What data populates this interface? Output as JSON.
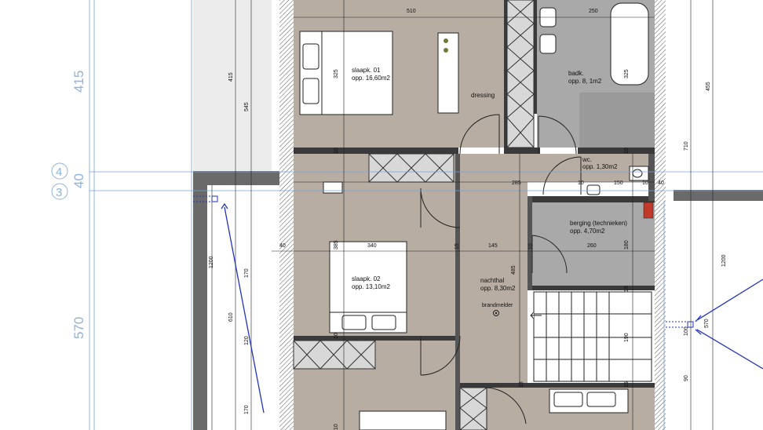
{
  "rooms": {
    "slaapk01": {
      "name": "slaapk. 01",
      "area": "opp. 16,60m2"
    },
    "dressing": {
      "name": "dressing"
    },
    "badk": {
      "name": "badk.",
      "area": "opp. 8, 1m2"
    },
    "wc": {
      "name": "wc.",
      "area": "opp. 1,30m2"
    },
    "berging": {
      "name": "berging (technieken)",
      "area": "opp. 4,70m2"
    },
    "slaapk02": {
      "name": "slaapk. 02",
      "area": "opp. 13,10m2"
    },
    "nachthal": {
      "name": "nachthal",
      "area": "opp. 8,30m2"
    },
    "brandmelder": "brandmelder"
  },
  "grid_axes": {
    "axis4": "4",
    "axis3": "3"
  },
  "big_dims": {
    "top": "415",
    "mid": "40",
    "bottom": "570"
  },
  "dims": {
    "d510": "510",
    "d250": "250",
    "d325a": "325",
    "d325b": "325",
    "d415": "415",
    "d545": "545",
    "d455": "455",
    "d710": "710",
    "d10a": "10",
    "d10b": "10",
    "d10c": "10",
    "d10d": "10",
    "d10e": "10",
    "d10f": "10",
    "d10g": "10",
    "d285": "285",
    "d150": "150",
    "d40a": "40",
    "d40b": "40",
    "d1200a": "1200",
    "d1200b": "1200",
    "d340": "340",
    "d385": "385",
    "d15a": "15",
    "d15b": "15",
    "d15c": "15",
    "d15d": "15",
    "d145": "145",
    "d260": "260",
    "d180": "180",
    "d485": "485",
    "d170a": "170",
    "d610": "610",
    "d120": "120",
    "d170b": "170",
    "d190": "190",
    "d570": "570",
    "d100": "100",
    "d90": "90"
  },
  "colors": {
    "floor": "#b8ada2",
    "wall": "#3a3a3a",
    "gridline": "#7aa3d6",
    "arrow": "#2233bb",
    "tile": "#a9a9a9"
  }
}
